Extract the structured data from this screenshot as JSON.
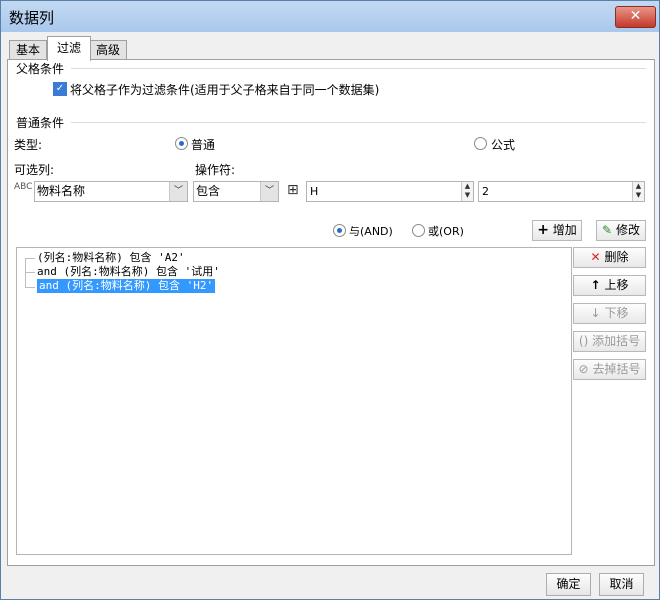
{
  "window": {
    "title": "数据列"
  },
  "tabs": [
    {
      "label": "基本"
    },
    {
      "label": "过滤"
    },
    {
      "label": "高级"
    }
  ],
  "parent_condition": {
    "title": "父格条件",
    "checkbox_label": "将父格子作为过滤条件(适用于父子格来自于同一个数据集)",
    "checked": true
  },
  "normal_condition": {
    "title": "普通条件",
    "type_label": "类型:",
    "type_options": [
      {
        "label": "普通",
        "selected": true
      },
      {
        "label": "公式",
        "selected": false
      }
    ],
    "column_label": "可选列:",
    "column_value": "物料名称",
    "operator_label": "操作符:",
    "operator_value": "包含",
    "value1": "H",
    "value2": "2"
  },
  "logic": {
    "and_label": "与(AND)",
    "or_label": "或(OR)",
    "and_selected": true,
    "add_label": "增加",
    "modify_label": "修改"
  },
  "conditions": [
    {
      "text": "(列名:物料名称) 包含 'A2'",
      "selected": false
    },
    {
      "text": "and (列名:物料名称) 包含 '试用'",
      "selected": false
    },
    {
      "text": "and (列名:物料名称) 包含 'H2'",
      "selected": true
    }
  ],
  "side_buttons": {
    "delete": "删除",
    "move_up": "上移",
    "move_down": "下移",
    "add_bracket": "添加括号",
    "remove_bracket": "去掉括号"
  },
  "footer": {
    "ok": "确定",
    "cancel": "取消"
  },
  "colors": {
    "accent": "#3399ff",
    "close": "#c4392a"
  }
}
